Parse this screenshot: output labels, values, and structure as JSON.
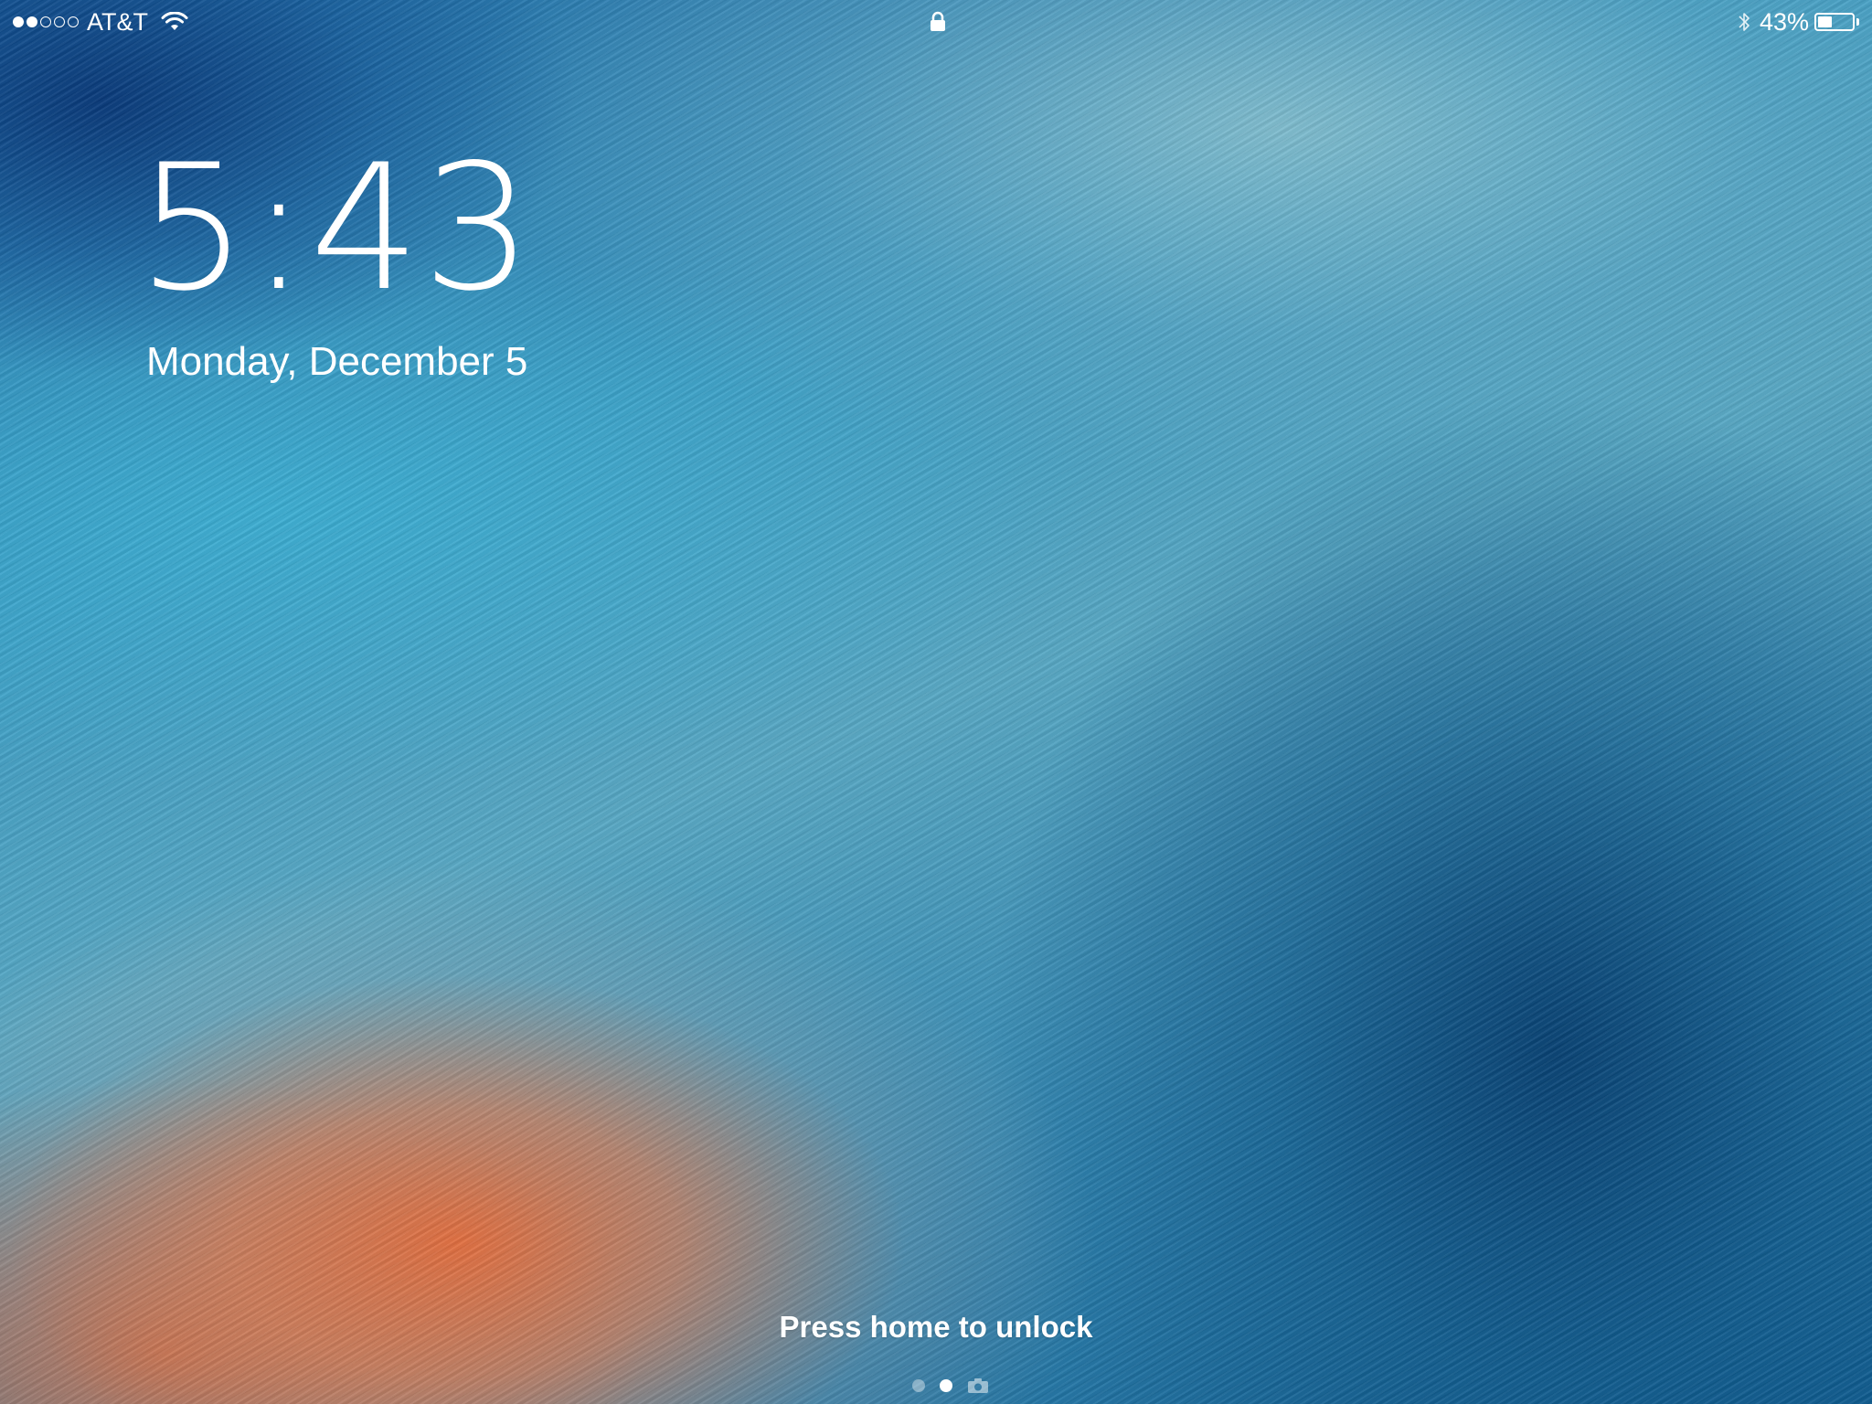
{
  "status_bar": {
    "signal_bars_filled": 2,
    "signal_bars_total": 5,
    "carrier": "AT&T",
    "wifi_icon": "wifi-icon",
    "lock_icon": "lock-icon",
    "bluetooth_icon": "bluetooth-icon",
    "battery_percent_label": "43%",
    "battery_level": 0.43
  },
  "lock_screen": {
    "time": "5:43",
    "date": "Monday, December 5",
    "unlock_hint": "Press home to unlock",
    "pages": [
      {
        "type": "dot",
        "active": false
      },
      {
        "type": "dot",
        "active": true
      },
      {
        "type": "camera",
        "icon": "camera-icon",
        "active": false
      }
    ]
  },
  "colors": {
    "text": "#ffffff",
    "wallpaper_blue": "#2f84b0",
    "wallpaper_orange": "#e86e3c"
  }
}
